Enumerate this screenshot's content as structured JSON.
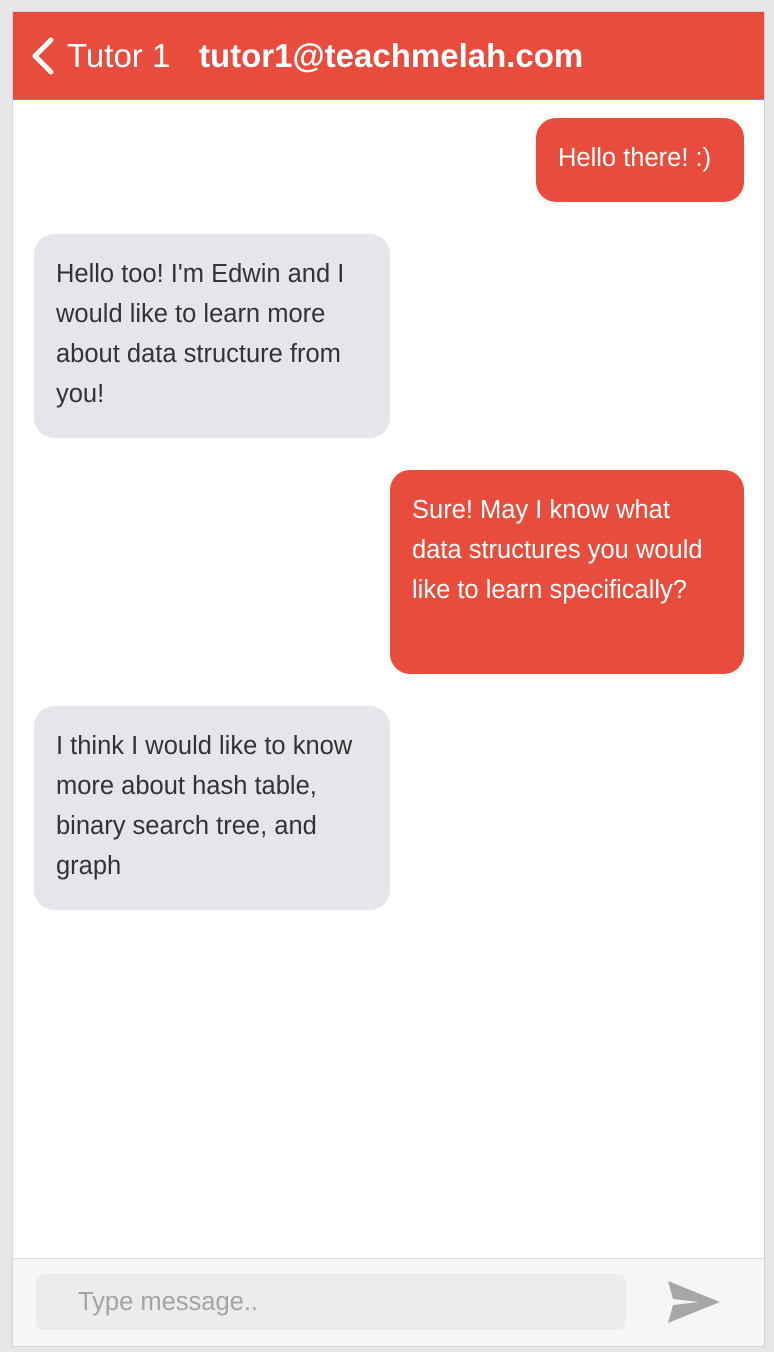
{
  "colors": {
    "accent": "#e84c3d",
    "received_bubble": "#e6e5eb",
    "send_icon": "#a7a7a7"
  },
  "header": {
    "back_icon": "chevron-left-icon",
    "title": "Tutor 1",
    "email": "tutor1@teachmelah.com"
  },
  "messages": [
    {
      "direction": "sent",
      "text": "Hello there! :)"
    },
    {
      "direction": "received",
      "text": "Hello too! I'm Edwin and I would like to learn more about data structure from you!"
    },
    {
      "direction": "sent",
      "text": "Sure! May I know what data structures you would like to learn specifically?"
    },
    {
      "direction": "received",
      "text": "I think I would like to know more about hash table, binary search tree, and graph"
    }
  ],
  "composer": {
    "placeholder": "Type message..",
    "value": "",
    "send_icon": "send-icon"
  }
}
